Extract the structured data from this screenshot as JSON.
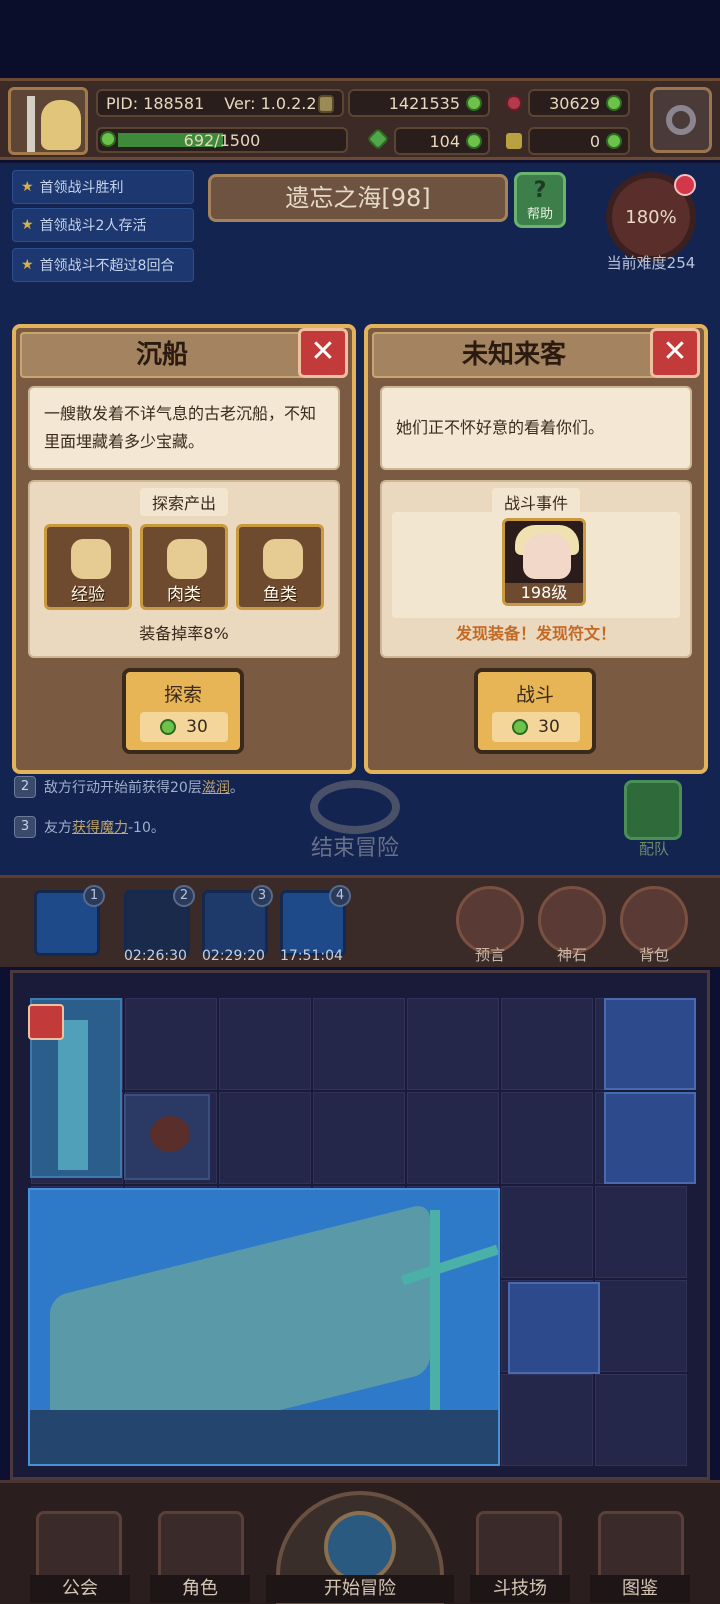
{
  "header": {
    "pid": "PID: 188581",
    "version": "Ver: 1.0.2.2",
    "gold": "1421535",
    "gems": "30629",
    "xp": "692/1500",
    "xp_fraction": 0.46,
    "clover": "104",
    "keys": "0"
  },
  "quests": [
    "首领战斗胜利",
    "首领战斗2人存活",
    "首领战斗不超过8回合"
  ],
  "map": {
    "title": "遗忘之海[98]",
    "help_label": "帮助",
    "difficulty_pct": "180%",
    "difficulty_label": "当前难度254"
  },
  "card_left": {
    "title": "沉船",
    "description": "一艘散发着不详气息的古老沉船，不知里面埋藏着多少宝藏。",
    "panel_title": "探索产出",
    "rewards": [
      "经验",
      "肉类",
      "鱼类"
    ],
    "footer": "装备掉率8%",
    "button_label": "探索",
    "button_cost": "30"
  },
  "card_right": {
    "title": "未知来客",
    "description": "她们正不怀好意的看着你们。",
    "panel_title": "战斗事件",
    "enemy_level": "198级",
    "footer": "发现装备！发现符文！",
    "button_label": "战斗",
    "button_cost": "30"
  },
  "notes": [
    {
      "num": "2",
      "pre": "敌方行动开始前获得20层",
      "link": "滋润",
      "post": "。"
    },
    {
      "num": "3",
      "pre": "友方",
      "link": "获得魔力",
      "post": "-10。"
    }
  ],
  "end_adventure": "结束冒险",
  "team_label": "配队",
  "tray": {
    "slots": [
      "1",
      "2",
      "3",
      "4"
    ],
    "timers": [
      "02:26:30",
      "02:29:20",
      "17:51:04"
    ],
    "buttons": [
      "预言",
      "神石",
      "背包"
    ]
  },
  "nav": {
    "guild": "公会",
    "character": "角色",
    "start": "开始冒险",
    "arena": "斗技场",
    "codex": "图鉴"
  }
}
